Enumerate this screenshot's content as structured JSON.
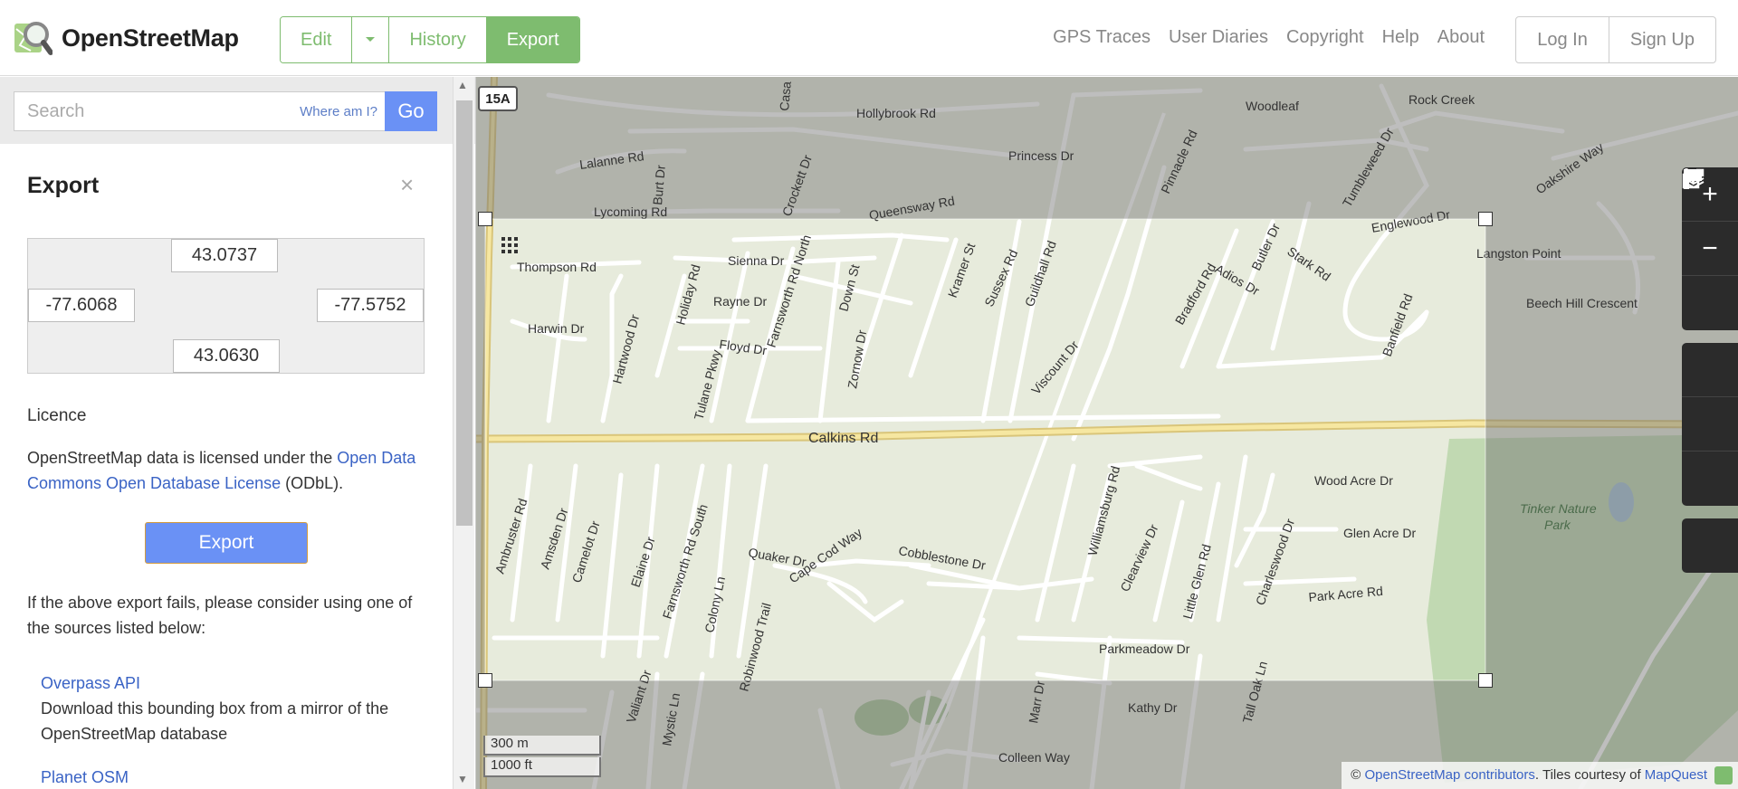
{
  "header": {
    "brand": "OpenStreetMap",
    "modes": [
      {
        "label": "Edit"
      },
      {
        "label": "History"
      },
      {
        "label": "Export"
      }
    ],
    "nav": [
      "GPS Traces",
      "User Diaries",
      "Copyright",
      "Help",
      "About"
    ],
    "auth": {
      "login": "Log In",
      "signup": "Sign Up"
    },
    "accent": "#7ebc6f"
  },
  "search": {
    "placeholder": "Search",
    "where_am_i": "Where am I?",
    "go": "Go"
  },
  "export": {
    "title": "Export",
    "close": "×",
    "bbox": {
      "north": "43.0737",
      "west": "-77.6068",
      "east": "-77.5752",
      "south": "43.0630"
    },
    "licence_heading": "Licence",
    "licence_pre": "OpenStreetMap data is licensed under the ",
    "licence_link": "Open Data Commons Open Database License",
    "licence_post": " (ODbL).",
    "export_button": "Export",
    "fail_text": "If the above export fails, please consider using one of the sources listed below:",
    "sources": [
      {
        "name": "Overpass API",
        "desc": "Download this bounding box from a mirror of the OpenStreetMap database"
      },
      {
        "name": "Planet OSM",
        "desc": ""
      }
    ]
  },
  "map": {
    "route_badge": "15A",
    "scale_metric": "300 m",
    "scale_imperial": "1000 ft",
    "attribution_prefix": "© ",
    "attribution_osm": "OpenStreetMap contributors",
    "attribution_mid": ". Tiles courtesy of ",
    "attribution_mq": "MapQuest",
    "labels": {
      "hollybrook": "Hollybrook Rd",
      "woodleaf": "Woodleaf",
      "rockcreek": "Rock Creek",
      "princess": "Princess Dr",
      "lalanne": "Lalanne Rd",
      "lycoming": "Lycoming Rd",
      "queensway": "Queensway Rd",
      "englewood": "Englewood Dr",
      "oakshire": "Oakshire Way",
      "langston": "Langston Point",
      "beechhill": "Beech Hill Crescent",
      "thompson": "Thompson Rd",
      "sienna": "Sienna Dr",
      "rayne": "Rayne Dr",
      "harwin": "Harwin Dr",
      "floyd": "Floyd Dr",
      "calkins": "Calkins Rd",
      "woodacre": "Wood Acre Dr",
      "glenacre": "Glen Acre Dr",
      "parkacre": "Park Acre Rd",
      "tinker": "Tinker Nature",
      "park": "Park",
      "quaker": "Quaker Dr",
      "capecod": "Cape Cod Way",
      "cobblestone": "Cobblestone Dr",
      "parkmeadow": "Parkmeadow Dr",
      "kathy": "Kathy Dr",
      "colleen": "Colleen Way",
      "farnsworthN": "Farnsworth Rd North",
      "farnsworthS": "Farnsworth Rd South",
      "williamsburg": "Williamsburg Rd",
      "clearview": "Clearview Dr",
      "charleswood": "Charleswood Dr",
      "viscount": "Viscount Dr",
      "guildhall": "Guildhall Rd",
      "sussex": "Sussex Rd",
      "kramer": "Kramer St",
      "down": "Down St",
      "zornow": "Zornow Dr",
      "hartwood": "Hartwood Dr",
      "holiday": "Holiday Rd",
      "tulane": "Tulane Pkwy",
      "bradford": "Bradford Rd",
      "adios": "Adios Dr",
      "butler": "Butler Dr",
      "stark": "Stark Rd",
      "banfield": "Banfield Rd",
      "pinnacle": "Pinnacle Rd",
      "tumbleweed": "Tumbleweed Dr",
      "ambruster": "Ambruster Rd",
      "amsden": "Amsden Dr",
      "camelot": "Camelot Dr",
      "elaine": "Elaine Dr",
      "colony": "Colony Ln",
      "robinwood": "Robinwood Trail",
      "littleglen": "Little Glen Rd",
      "tailoak": "Tall Oak Ln",
      "marr": "Marr Dr",
      "crockett": "Crockett Dr",
      "burt": "Burt Dr",
      "casa": "Casa",
      "mystic": "Mystic Ln",
      "valiant": "Valiant Dr"
    }
  }
}
